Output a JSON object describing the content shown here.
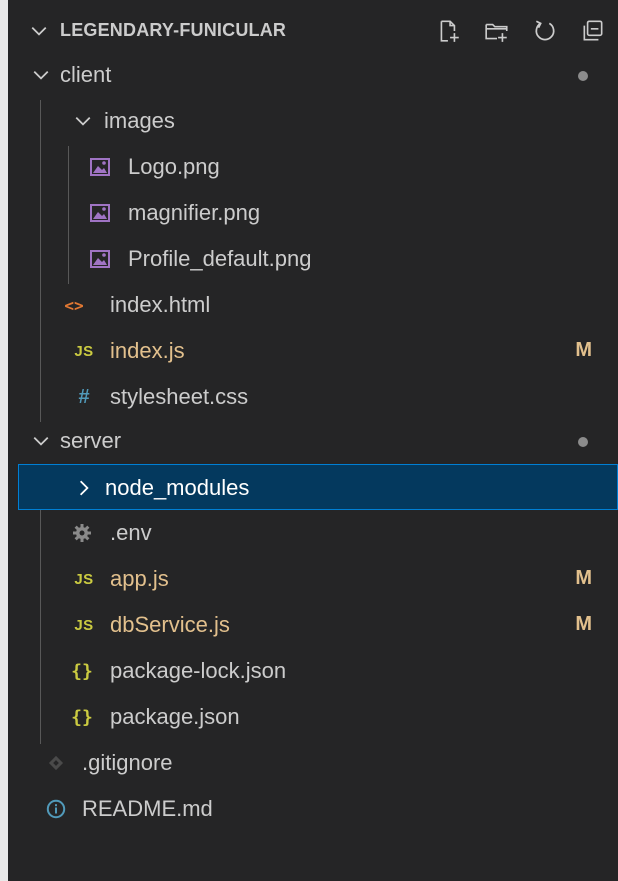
{
  "explorer": {
    "title": "LEGENDARY-FUNICULAR",
    "actions": [
      {
        "name": "new-file-icon"
      },
      {
        "name": "new-folder-icon"
      },
      {
        "name": "refresh-icon"
      },
      {
        "name": "collapse-all-icon"
      }
    ]
  },
  "tree": {
    "client": {
      "label": "client"
    },
    "images": {
      "label": "images"
    },
    "logo_png": {
      "label": "Logo.png"
    },
    "magnifier_png": {
      "label": "magnifier.png"
    },
    "profile_default_png": {
      "label": "Profile_default.png"
    },
    "index_html": {
      "label": "index.html"
    },
    "index_js": {
      "label": "index.js",
      "badge": "M"
    },
    "stylesheet_css": {
      "label": "stylesheet.css"
    },
    "server": {
      "label": "server"
    },
    "node_modules": {
      "label": "node_modules"
    },
    "env": {
      "label": ".env"
    },
    "app_js": {
      "label": "app.js",
      "badge": "M"
    },
    "dbservice_js": {
      "label": "dbService.js",
      "badge": "M"
    },
    "package_lock_json": {
      "label": "package-lock.json"
    },
    "package_json": {
      "label": "package.json"
    },
    "gitignore": {
      "label": ".gitignore"
    },
    "readme_md": {
      "label": "README.md"
    }
  },
  "icons": {
    "js": "JS",
    "css": "#",
    "json": "{}",
    "html": "<>"
  },
  "colors": {
    "background": "#252526",
    "text": "#cccccc",
    "modified": "#e2c08d",
    "selection_bg": "#04395e",
    "selection_border": "#007fd4",
    "image_icon": "#a074c4",
    "js_icon": "#cbcb41",
    "css_icon": "#519aba",
    "html_icon": "#e37933"
  }
}
